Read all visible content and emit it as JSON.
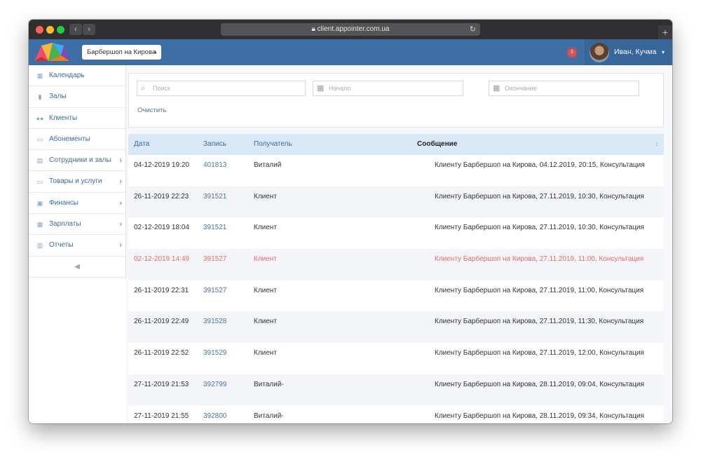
{
  "browser": {
    "url": "client.appointer.com.ua"
  },
  "header": {
    "location_select": "Барбершоп на Кирова",
    "notification_count": "5",
    "user_name": "Иван, Кучма"
  },
  "sidebar": {
    "items": [
      {
        "label": "Календарь",
        "icon": "calendar-icon",
        "has_submenu": false
      },
      {
        "label": "Залы",
        "icon": "bookmark-icon",
        "has_submenu": false
      },
      {
        "label": "Клиенты",
        "icon": "users-icon",
        "has_submenu": false
      },
      {
        "label": "Абонементы",
        "icon": "card-icon",
        "has_submenu": false
      },
      {
        "label": "Сотрудники и залы",
        "icon": "id-card-icon",
        "has_submenu": true
      },
      {
        "label": "Товары и услуги",
        "icon": "card-icon",
        "has_submenu": true
      },
      {
        "label": "Финансы",
        "icon": "money-icon",
        "has_submenu": true
      },
      {
        "label": "Зарплаты",
        "icon": "calculator-icon",
        "has_submenu": true
      },
      {
        "label": "Отчеты",
        "icon": "chart-icon",
        "has_submenu": true
      }
    ]
  },
  "filters": {
    "search_placeholder": "Поиск",
    "start_placeholder": "Начало",
    "end_placeholder": "Окончание",
    "clear_label": "Очистить"
  },
  "table": {
    "columns": [
      "Дата",
      "Запись",
      "Получатель",
      "Сообщение"
    ],
    "rows": [
      {
        "date": "04-12-2019 19:20",
        "record": "401813",
        "recipient": "Виталий",
        "message": "Клиенту Барбершоп на Кирова, 04.12.2019, 20:15, Консультация",
        "status": "ok"
      },
      {
        "date": "26-11-2019 22:23",
        "record": "391521",
        "recipient": "Клиент",
        "message": "Клиенту Барбершоп на Кирова, 27.11.2019, 10:30, Консультация",
        "status": "ok"
      },
      {
        "date": "02-12-2019 18:04",
        "record": "391521",
        "recipient": "Клиент",
        "message": "Клиенту Барбершоп на Кирова, 27.11.2019, 10:30, Консультация",
        "status": "ok"
      },
      {
        "date": "02-12-2019 14:49",
        "record": "391527",
        "recipient": "Клиент",
        "message": "Клиенту Барбершоп на Кирова, 27.11.2019, 11:00, Консультация",
        "status": "error"
      },
      {
        "date": "26-11-2019 22:31",
        "record": "391527",
        "recipient": "Клиент",
        "message": "Клиенту Барбершоп на Кирова, 27.11.2019, 11:00, Консультация",
        "status": "ok"
      },
      {
        "date": "26-11-2019 22:49",
        "record": "391528",
        "recipient": "Клиент",
        "message": "Клиенту Барбершоп на Кирова, 27.11.2019, 11:30, Консультация",
        "status": "ok"
      },
      {
        "date": "26-11-2019 22:52",
        "record": "391529",
        "recipient": "Клиент",
        "message": "Клиенту Барбершоп на Кирова, 27.11.2019, 12:00, Консультация",
        "status": "ok"
      },
      {
        "date": "27-11-2019 21:53",
        "record": "392799",
        "recipient": "Виталий-",
        "message": "Клиенту Барбершоп на Кирова, 28.11.2019, 09:04, Консультация",
        "status": "ok"
      },
      {
        "date": "27-11-2019 21:55",
        "record": "392800",
        "recipient": "Виталий-",
        "message": "Клиенту Барбершоп на Кирова, 28.11.2019, 09:34, Консультация",
        "status": "ok"
      }
    ]
  },
  "colors": {
    "appbar": "#3d6fa5",
    "link": "#4a76a8",
    "header_row": "#d9e8f7",
    "error_text": "#e56a6a"
  }
}
